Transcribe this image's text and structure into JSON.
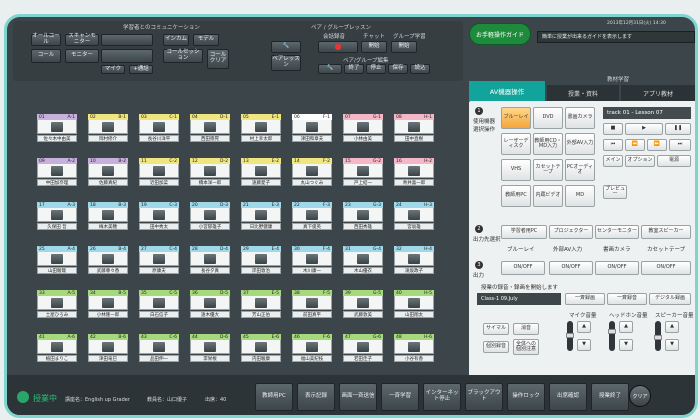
{
  "top": {
    "learning_label": "学習者とのコミュニケーション",
    "pair_label": "ペア / グループレッスン",
    "buttons": {
      "all_call": "オールコール",
      "scan_monitor": "スキャンモニター",
      "intercom": "インカム",
      "model": "モデル",
      "call": "コール",
      "monitor": "モニター",
      "mic": "マイク",
      "plus_call": "+通話",
      "call_session": "コールセッション",
      "call_clear": "コールクリア",
      "meeting_speaker": "会話録音",
      "chat": "チャット",
      "group_learn": "グループ学習",
      "pair_lesson": "ペアレッスン",
      "pair_group_edit": "ペア/グループ編集",
      "start": "開始",
      "start2": "開始",
      "end": "終了",
      "stop": "停止",
      "save": "保存",
      "read": "読込"
    },
    "guide_btn": "お手軽操作ガイド",
    "datetime": "2013年12月31日(火) 14:30",
    "guide_message": "簡単に授業が出来るガイドを表示します",
    "tabs": [
      "AV機器操作",
      "授業・資料",
      "アプリ教材"
    ],
    "tab_top_label": "教材学習"
  },
  "seats": [
    [
      {
        "id": "01",
        "tag": "A-1",
        "color": "#c8b0dd",
        "name": "佐々木中由美"
      },
      {
        "id": "02",
        "tag": "B-1",
        "color": "#f0e67f",
        "name": "岡村修介"
      },
      {
        "id": "03",
        "tag": "C-1",
        "color": "#f0e67f",
        "name": "長谷川洋平"
      },
      {
        "id": "04",
        "tag": "D-1",
        "color": "#f0e67f",
        "name": "西田徳晃"
      },
      {
        "id": "05",
        "tag": "E-1",
        "color": "#f0e67f",
        "name": "村上幸太郎"
      },
      {
        "id": "06",
        "tag": "F-1",
        "color": "#ffffff",
        "name": "津田和章夫"
      },
      {
        "id": "07",
        "tag": "G-1",
        "color": "#f4b7c7",
        "name": "小林由美"
      },
      {
        "id": "08",
        "tag": "H-1",
        "color": "#f4b7c7",
        "name": "田中直樹"
      }
    ],
    [
      {
        "id": "09",
        "tag": "A-2",
        "color": "#c8b0dd",
        "name": "中田加奈理"
      },
      {
        "id": "10",
        "tag": "B-2",
        "color": "#c8b0dd",
        "name": "佐藤真紀"
      },
      {
        "id": "11",
        "tag": "C-2",
        "color": "#f0e67f",
        "name": "近田加菜"
      },
      {
        "id": "12",
        "tag": "D-2",
        "color": "#f0e67f",
        "name": "橋本洋一郎"
      },
      {
        "id": "13",
        "tag": "E-2",
        "color": "#f0e67f",
        "name": "遠藤愛子"
      },
      {
        "id": "14",
        "tag": "F-2",
        "color": "#f0e67f",
        "name": "丸山つぐみ"
      },
      {
        "id": "15",
        "tag": "G-2",
        "color": "#f4b7c7",
        "name": "戸上結一"
      },
      {
        "id": "16",
        "tag": "H-2",
        "color": "#f4b7c7",
        "name": "青井喜一郎"
      }
    ],
    [
      {
        "id": "17",
        "tag": "A-3",
        "color": "#9fd8e8",
        "name": "久保田 哲"
      },
      {
        "id": "18",
        "tag": "B-3",
        "color": "#9fd8e8",
        "name": "梅木美穂"
      },
      {
        "id": "19",
        "tag": "C-3",
        "color": "#9fd8e8",
        "name": "田中秀太"
      },
      {
        "id": "20",
        "tag": "D-3",
        "color": "#9fd8e8",
        "name": "小宮郁雄子"
      },
      {
        "id": "21",
        "tag": "E-3",
        "color": "#9fd8e8",
        "name": "日比野健康"
      },
      {
        "id": "22",
        "tag": "F-3",
        "color": "#9fd8e8",
        "name": "真下俊英"
      },
      {
        "id": "23",
        "tag": "G-3",
        "color": "#9fd8e8",
        "name": "西田秀雄"
      },
      {
        "id": "24",
        "tag": "H-3",
        "color": "#9fd8e8",
        "name": "宮坂雄"
      }
    ],
    [
      {
        "id": "25",
        "tag": "A-4",
        "color": "#9fd8e8",
        "name": "山田駿哉"
      },
      {
        "id": "26",
        "tag": "B-4",
        "color": "#9fd8e8",
        "name": "武藤尊々香"
      },
      {
        "id": "27",
        "tag": "C-4",
        "color": "#9fd8e8",
        "name": "原康夫"
      },
      {
        "id": "28",
        "tag": "D-4",
        "color": "#9fd8e8",
        "name": "長谷夕真"
      },
      {
        "id": "29",
        "tag": "E-4",
        "color": "#9fd8e8",
        "name": "岸田敦治"
      },
      {
        "id": "30",
        "tag": "F-4",
        "color": "#9fd8e8",
        "name": "木川康一"
      },
      {
        "id": "31",
        "tag": "G-4",
        "color": "#9fd8e8",
        "name": "木山優衣"
      },
      {
        "id": "32",
        "tag": "H-4",
        "color": "#9fd8e8",
        "name": "滝坂政子"
      }
    ],
    [
      {
        "id": "33",
        "tag": "A-5",
        "color": "#a6d87c",
        "name": "土屋ひろみ"
      },
      {
        "id": "34",
        "tag": "B-5",
        "color": "#a6d87c",
        "name": "小林隆一郎"
      },
      {
        "id": "35",
        "tag": "C-5",
        "color": "#a6d87c",
        "name": "白石信子"
      },
      {
        "id": "36",
        "tag": "D-5",
        "color": "#a6d87c",
        "name": "遠木優大"
      },
      {
        "id": "37",
        "tag": "E-5",
        "color": "#a6d87c",
        "name": "芳山正伯"
      },
      {
        "id": "38",
        "tag": "F-5",
        "color": "#a6d87c",
        "name": "前田真平"
      },
      {
        "id": "39",
        "tag": "G-5",
        "color": "#a6d87c",
        "name": "武藤敦美"
      },
      {
        "id": "40",
        "tag": "H-5",
        "color": "#a6d87c",
        "name": "山田翔太"
      }
    ],
    [
      {
        "id": "41",
        "tag": "A-6",
        "color": "#a6d87c",
        "name": "植田まりこ"
      },
      {
        "id": "42",
        "tag": "B-6",
        "color": "#a6d87c",
        "name": "津田竜巳"
      },
      {
        "id": "43",
        "tag": "C-6",
        "color": "#a6d87c",
        "name": "品田伸一"
      },
      {
        "id": "44",
        "tag": "D-6",
        "color": "#a6d87c",
        "name": "李栄根"
      },
      {
        "id": "45",
        "tag": "E-6",
        "color": "#a6d87c",
        "name": "内田駿康"
      },
      {
        "id": "46",
        "tag": "F-6",
        "color": "#a6d87c",
        "name": "福山美紀枝"
      },
      {
        "id": "47",
        "tag": "G-6",
        "color": "#a6d87c",
        "name": "若田佳子"
      },
      {
        "id": "48",
        "tag": "H-6",
        "color": "#a6d87c",
        "name": "小谷有香"
      }
    ]
  ],
  "av": {
    "step1": "使用機器選択操作",
    "devices": [
      "ブルーレイ",
      "DVD",
      "書画カメラ",
      "レーザーディスク",
      "教師用CD・MD入力",
      "外部AV入力",
      "VHS",
      "カセットテープ",
      "PCオーディオ",
      "教師用PC",
      "内蔵ビデオ",
      "MD"
    ],
    "preview": "プレビュー",
    "track": "track 01 - Lesson 07",
    "ctrl_labels": [
      "メイン",
      "オプション",
      "電源"
    ],
    "step2": "出力先選択",
    "outputs": [
      "学習者用PC",
      "プロジェクター",
      "センターモニター",
      "教室スピーカー"
    ],
    "out_sub": [
      "ブルーレイ",
      "外部AV入力",
      "書画カメラ",
      "カセットテープ"
    ],
    "step3": "出力",
    "on_off": [
      "ON/OFF",
      "ON/OFF",
      "ON/OFF",
      "ON/OFF"
    ],
    "status_text": "授業の録音・録画を開始します",
    "class_label": "Class-1 09.July",
    "rec1": "一斉録画",
    "rec2": "一斉録音",
    "rec3": "デジタル録画",
    "vol_labels": [
      "マイク音量",
      "ヘッドホン音量",
      "スピーカー音量"
    ],
    "btm_btns": [
      "サイマル",
      "消音",
      "個別録音",
      "全体への個別注意"
    ]
  },
  "status": {
    "state": "授業中",
    "course": "講座名：English up Grader",
    "teacher": "教員名：山口優子",
    "attend": "出席：40"
  },
  "bottom": [
    "教師用PC",
    "表示記録",
    "画面一斉送信",
    "一斉学習",
    "インターネット停止",
    "ブラックアウト",
    "操作ロック",
    "出席確認",
    "授業終了"
  ],
  "clear": "クリア"
}
